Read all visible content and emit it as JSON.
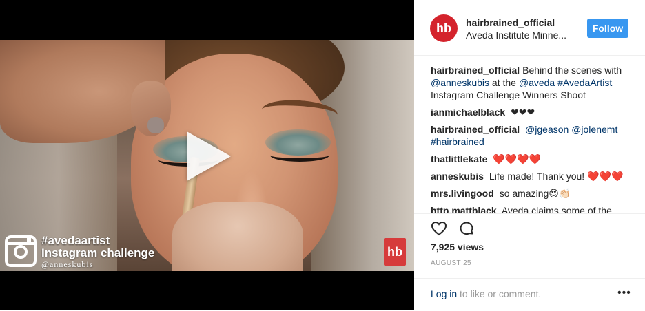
{
  "video": {
    "watermark_tag": "#avedaartist",
    "watermark_title": "Instagram challenge",
    "watermark_handle": "@anneskubis",
    "watermark_logo": "hb",
    "play_icon": "play-icon",
    "instagram_icon": "instagram-camera-icon"
  },
  "header": {
    "avatar_text": "hb",
    "username": "hairbrained_official",
    "location": "Aveda Institute Minne...",
    "follow_label": "Follow"
  },
  "comments": [
    {
      "user": "hairbrained_official",
      "text": "Behind the scenes with ",
      "link1": "@anneskubis",
      "text2": " at the ",
      "link2": "@aveda",
      "text3": " ",
      "link3": "#AvedaArtist",
      "text4": " Instagram Challenge Winners Shoot"
    },
    {
      "user": "ianmichaelblack",
      "text": "❤❤❤"
    },
    {
      "user": "hairbrained_official",
      "link1": "@jgeason",
      "link2": "@jolenemt",
      "link3": "#hairbrained"
    },
    {
      "user": "thatlittlekate",
      "text": "❤️❤️❤️❤️"
    },
    {
      "user": "anneskubis",
      "text": "Life made! Thank you! ❤️❤️❤️"
    },
    {
      "user": "mrs.livingood",
      "text": "so amazing😍👏🏻"
    },
    {
      "user": "http.mattblack",
      "text": "Aveda claims some of the"
    }
  ],
  "actions": {
    "like_icon": "heart-icon",
    "comment_icon": "comment-icon"
  },
  "stats": {
    "views": "7,925 views",
    "date": "AUGUST 25"
  },
  "footer": {
    "login_link": "Log in",
    "login_text": " to like or comment.",
    "more": "•••"
  },
  "colors": {
    "follow_bg": "#3897f0",
    "brand_red": "#d4232c",
    "link": "#003569",
    "muted": "#999999"
  }
}
